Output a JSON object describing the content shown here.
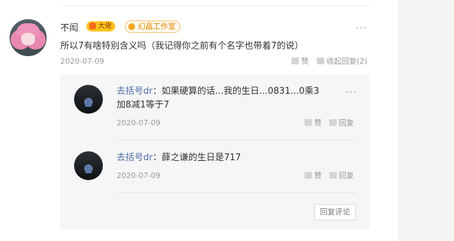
{
  "comment": {
    "username": "不闳",
    "badge_level": "大佬",
    "badge_studio": "幻晶工作室",
    "text": "所以7有啥特别含义吗（我记得你之前有个名字也带着7的说）",
    "date": "2020-07-09",
    "like_label": "赞",
    "collapse_label": "收起回复(2)",
    "more_icon": "···"
  },
  "replies": [
    {
      "username": "去括号dr",
      "separator": "：",
      "line1": "如果硬算的话...我的生日...0831...0乘3",
      "line2": "加8减1等于7",
      "date": "2020-07-09",
      "like_label": "赞",
      "reply_label": "回复"
    },
    {
      "username": "去括号dr",
      "separator": "：",
      "line1": "薛之谦的生日是717",
      "date": "2020-07-09",
      "like_label": "赞",
      "reply_label": "回复"
    }
  ],
  "reply_button": "回复评论"
}
